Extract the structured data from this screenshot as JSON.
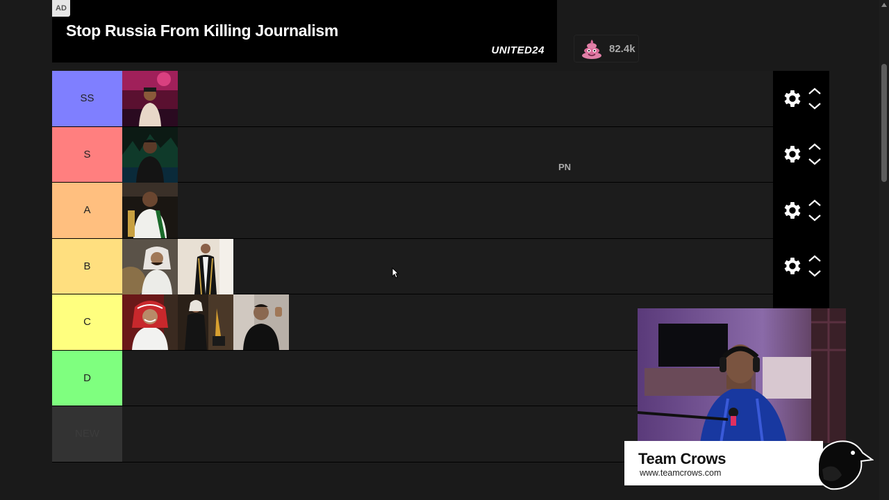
{
  "ad": {
    "label": "AD",
    "headline": "Stop Russia From Killing Journalism",
    "brand": "UNITED24"
  },
  "reaction": {
    "icon": "poo-emoji-icon",
    "count": "82.4k"
  },
  "tiers": [
    {
      "label": "SS",
      "color": "#7f7fff",
      "items": 1
    },
    {
      "label": "S",
      "color": "#ff7f7f",
      "items": 1
    },
    {
      "label": "A",
      "color": "#ffbf7f",
      "items": 1
    },
    {
      "label": "B",
      "color": "#ffdf7f",
      "items": 2
    },
    {
      "label": "C",
      "color": "#ffff7f",
      "items": 3
    },
    {
      "label": "D",
      "color": "#7fff7f",
      "items": 0
    },
    {
      "label": "NEW",
      "color": "#333333",
      "items": 0
    }
  ],
  "floating_text": "PN",
  "stream": {
    "team_name": "Team Crows",
    "team_url": "www.teamcrows.com"
  }
}
